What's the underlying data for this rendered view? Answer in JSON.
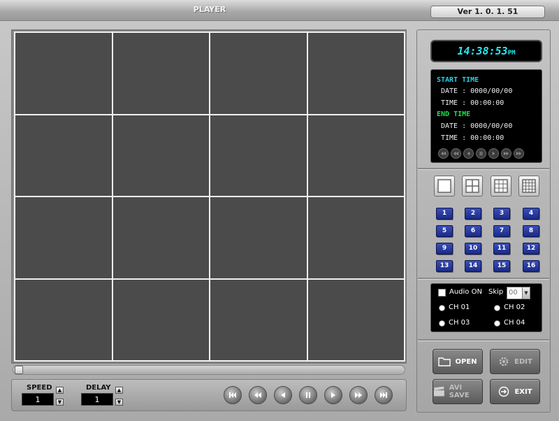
{
  "window": {
    "title": "PLAYER",
    "version": "Ver 1. 0. 1. 51"
  },
  "clock": {
    "time": "14:38:53",
    "ampm": "PM"
  },
  "search_info": {
    "start_label": "START TIME",
    "start_date": "DATE : 0000/00/00",
    "start_time": "TIME : 00:00:00",
    "end_label": "END TIME",
    "end_date": "DATE : 0000/00/00",
    "end_time": "TIME : 00:00:00",
    "colors": {
      "start": "#23d0e8",
      "end": "#1fe04a",
      "text": "#f0f0f0"
    }
  },
  "layouts": [
    "single-view-icon",
    "quad-view-icon",
    "nine-view-icon",
    "sixteen-view-icon"
  ],
  "channels": [
    "1",
    "2",
    "3",
    "4",
    "5",
    "6",
    "7",
    "8",
    "9",
    "10",
    "11",
    "12",
    "13",
    "14",
    "15",
    "16"
  ],
  "audio": {
    "audio_label": "Audio ON",
    "skip_label": "Skip",
    "skip_value": "00",
    "channels": [
      "CH 01",
      "CH 02",
      "CH 03",
      "CH 04"
    ]
  },
  "controls": {
    "speed_label": "SPEED",
    "speed_value": "1",
    "delay_label": "DELAY",
    "delay_value": "1"
  },
  "actions": {
    "open": "OPEN",
    "edit": "EDIT",
    "avi_save": "AVI SAVE",
    "exit": "EXIT"
  },
  "video_grid": {
    "rows": 4,
    "cols": 4,
    "cell_color": "#4b4b4b"
  }
}
